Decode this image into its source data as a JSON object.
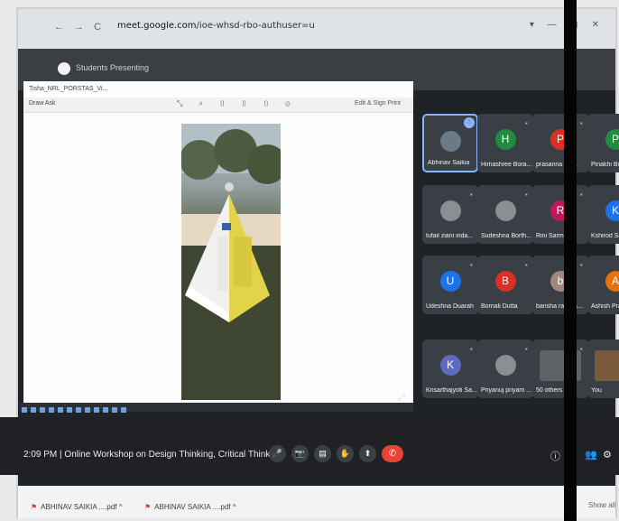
{
  "browser": {
    "nav_icons": "← → C",
    "url_domain": "meet.google.com",
    "url_path": "/ioe-whsd-rbo-authuser=u",
    "window_controls": "▾  —  ▢  ✕"
  },
  "meet": {
    "title": "Students Presenting"
  },
  "presentation": {
    "filename": "Tisha_NRL_PORSTAS_Vi...",
    "toolbar_left": "Draw  Ask",
    "toolbar_mid": "⤡ ⌕ ▯ ▯ ▯ ⊘",
    "toolbar_right": "Edit & Sign  Print"
  },
  "participants": [
    {
      "name": "Abhinav Saikia",
      "initial": "",
      "color": "#6b7a86",
      "speaking": true,
      "photo": "person"
    },
    {
      "name": "Himashree Bora...",
      "initial": "H",
      "color": "#1e8e3e"
    },
    {
      "name": "prasanna Ha...",
      "initial": "P",
      "color": "#d93025"
    },
    {
      "name": "Pinakhi Bor...",
      "initial": "P",
      "color": "#1e8e3e"
    },
    {
      "name": "tufail ziani inda...",
      "initial": "",
      "color": "#8a8f93",
      "photo": "person"
    },
    {
      "name": "Sudeshna Borth...",
      "initial": "",
      "color": "#8a8f93",
      "photo": "flower"
    },
    {
      "name": "Rini Sarmah",
      "initial": "R",
      "color": "#c2185b"
    },
    {
      "name": "Kshirod Saik...",
      "initial": "K",
      "color": "#1a73e8"
    },
    {
      "name": "Udeshna Duarah",
      "initial": "U",
      "color": "#1a73e8"
    },
    {
      "name": "Bornali Dutta",
      "initial": "B",
      "color": "#d93025"
    },
    {
      "name": "bansha rani ka...",
      "initial": "b",
      "color": "#a1887f"
    },
    {
      "name": "Ashish Prati...",
      "initial": "A",
      "color": "#e8710a"
    },
    {
      "name": "Krisarthajyoti Sa...",
      "initial": "K",
      "color": "#5c6bc0"
    },
    {
      "name": "Priyanuj priyam ...",
      "initial": "",
      "color": "#8a8f93",
      "photo": "person"
    },
    {
      "name": "50 others",
      "initial": "",
      "color": "#5f6368",
      "photo": "group"
    },
    {
      "name": "You",
      "initial": "",
      "color": "#7a5a3a",
      "photo": "self"
    }
  ],
  "meeting_info": {
    "time": "2:09 PM",
    "separator": "|",
    "title": "Online Workshop on Design Thinking, Critical Thinki..."
  },
  "controls": [
    "🎤",
    "📷",
    "▤",
    "✋",
    "⬆",
    "⋮"
  ],
  "end_call_icon": "✆",
  "right_controls": [
    "ⓘ",
    "👥",
    "⚙"
  ],
  "downloads": [
    {
      "file": "ABHINAV SAIKIA ....pdf",
      "chevron": "^"
    },
    {
      "file": "ABHINAV SAIKIA ....pdf",
      "chevron": "^"
    }
  ],
  "downloads_show_all": "Show all"
}
